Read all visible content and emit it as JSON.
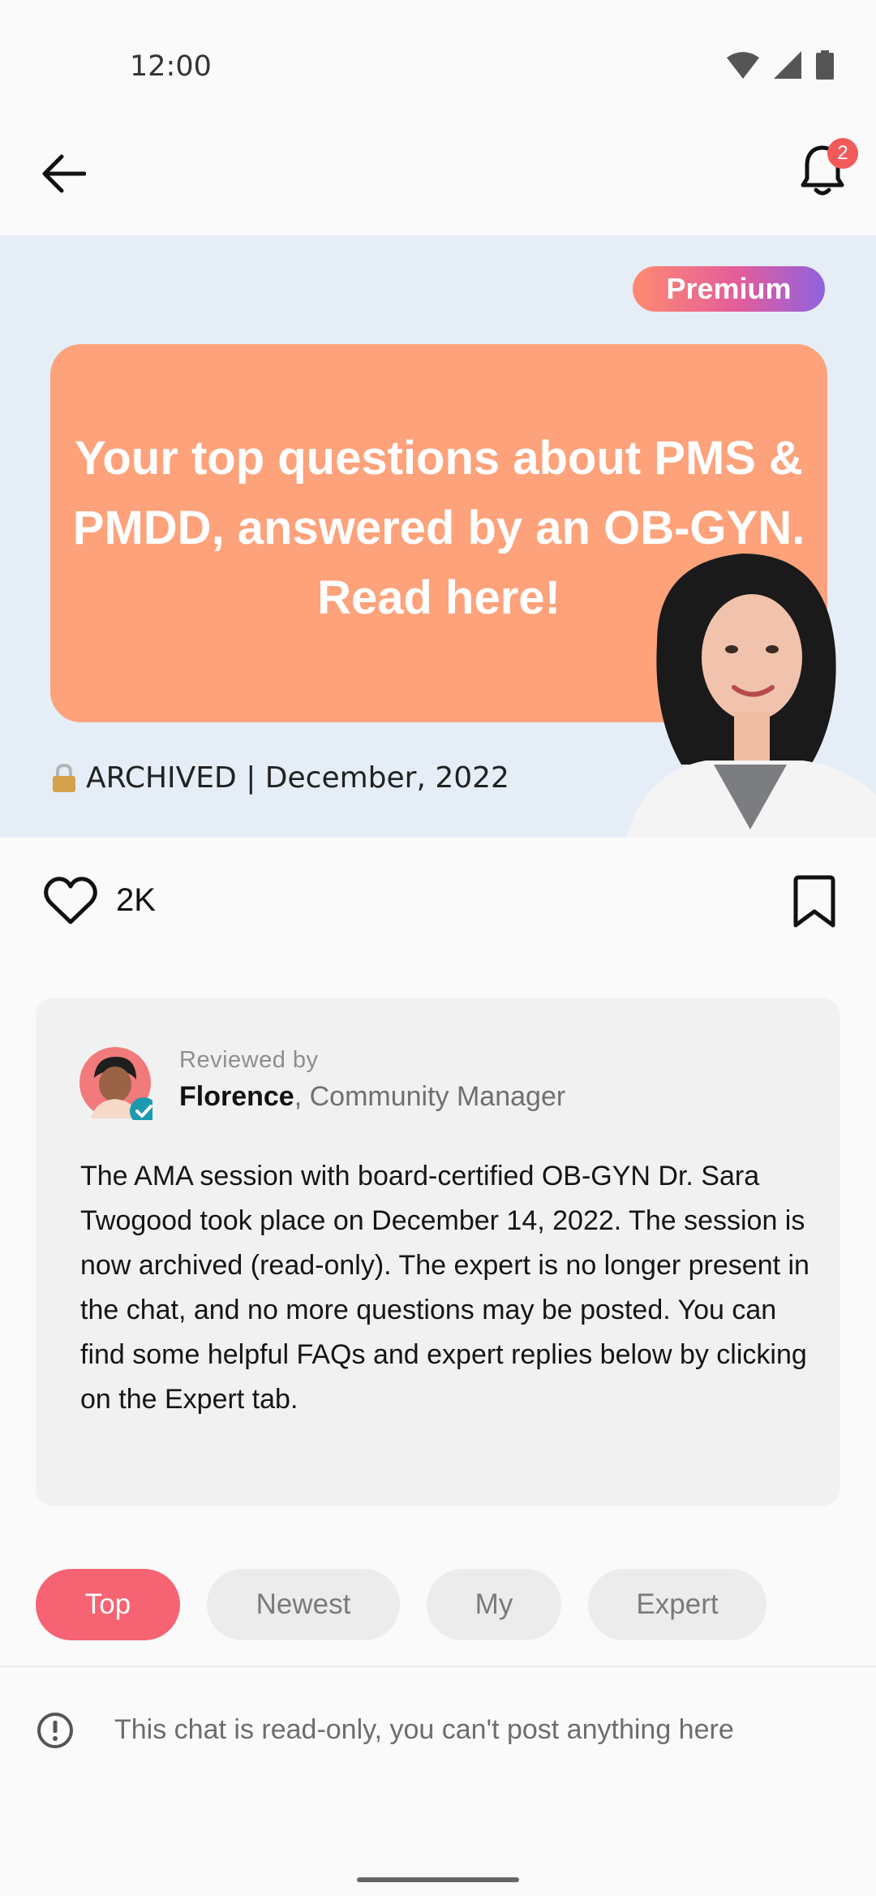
{
  "status_bar": {
    "time": "12:00"
  },
  "header": {
    "notification_count": "2"
  },
  "hero": {
    "badge": "Premium",
    "title": "Your top questions about PMS & PMDD, answered by an OB-GYN. Read here!",
    "archived_text": "ARCHIVED | December, 2022"
  },
  "actions": {
    "like_count": "2K"
  },
  "info_card": {
    "reviewed_label": "Reviewed by",
    "reviewer_name": "Florence",
    "reviewer_role": ", Community Manager",
    "body": "The AMA session with board-certified OB-GYN Dr. Sara Twogood took place on December 14, 2022. The session is now archived (read-only). The expert is no longer present in the chat, and no more questions may be posted. You can find some helpful FAQs and expert replies below by clicking on the Expert tab."
  },
  "tabs": [
    {
      "label": "Top",
      "active": true
    },
    {
      "label": "Newest",
      "active": false
    },
    {
      "label": "My",
      "active": false
    },
    {
      "label": "Expert",
      "active": false
    }
  ],
  "notice": {
    "text": "This chat is read-only, you can't post anything here"
  },
  "colors": {
    "accent": "#f66373",
    "hero_bg": "#e5eef7",
    "hero_card": "#fda27b",
    "badge_red": "#f25a5a",
    "verified": "#1b9ab0"
  }
}
